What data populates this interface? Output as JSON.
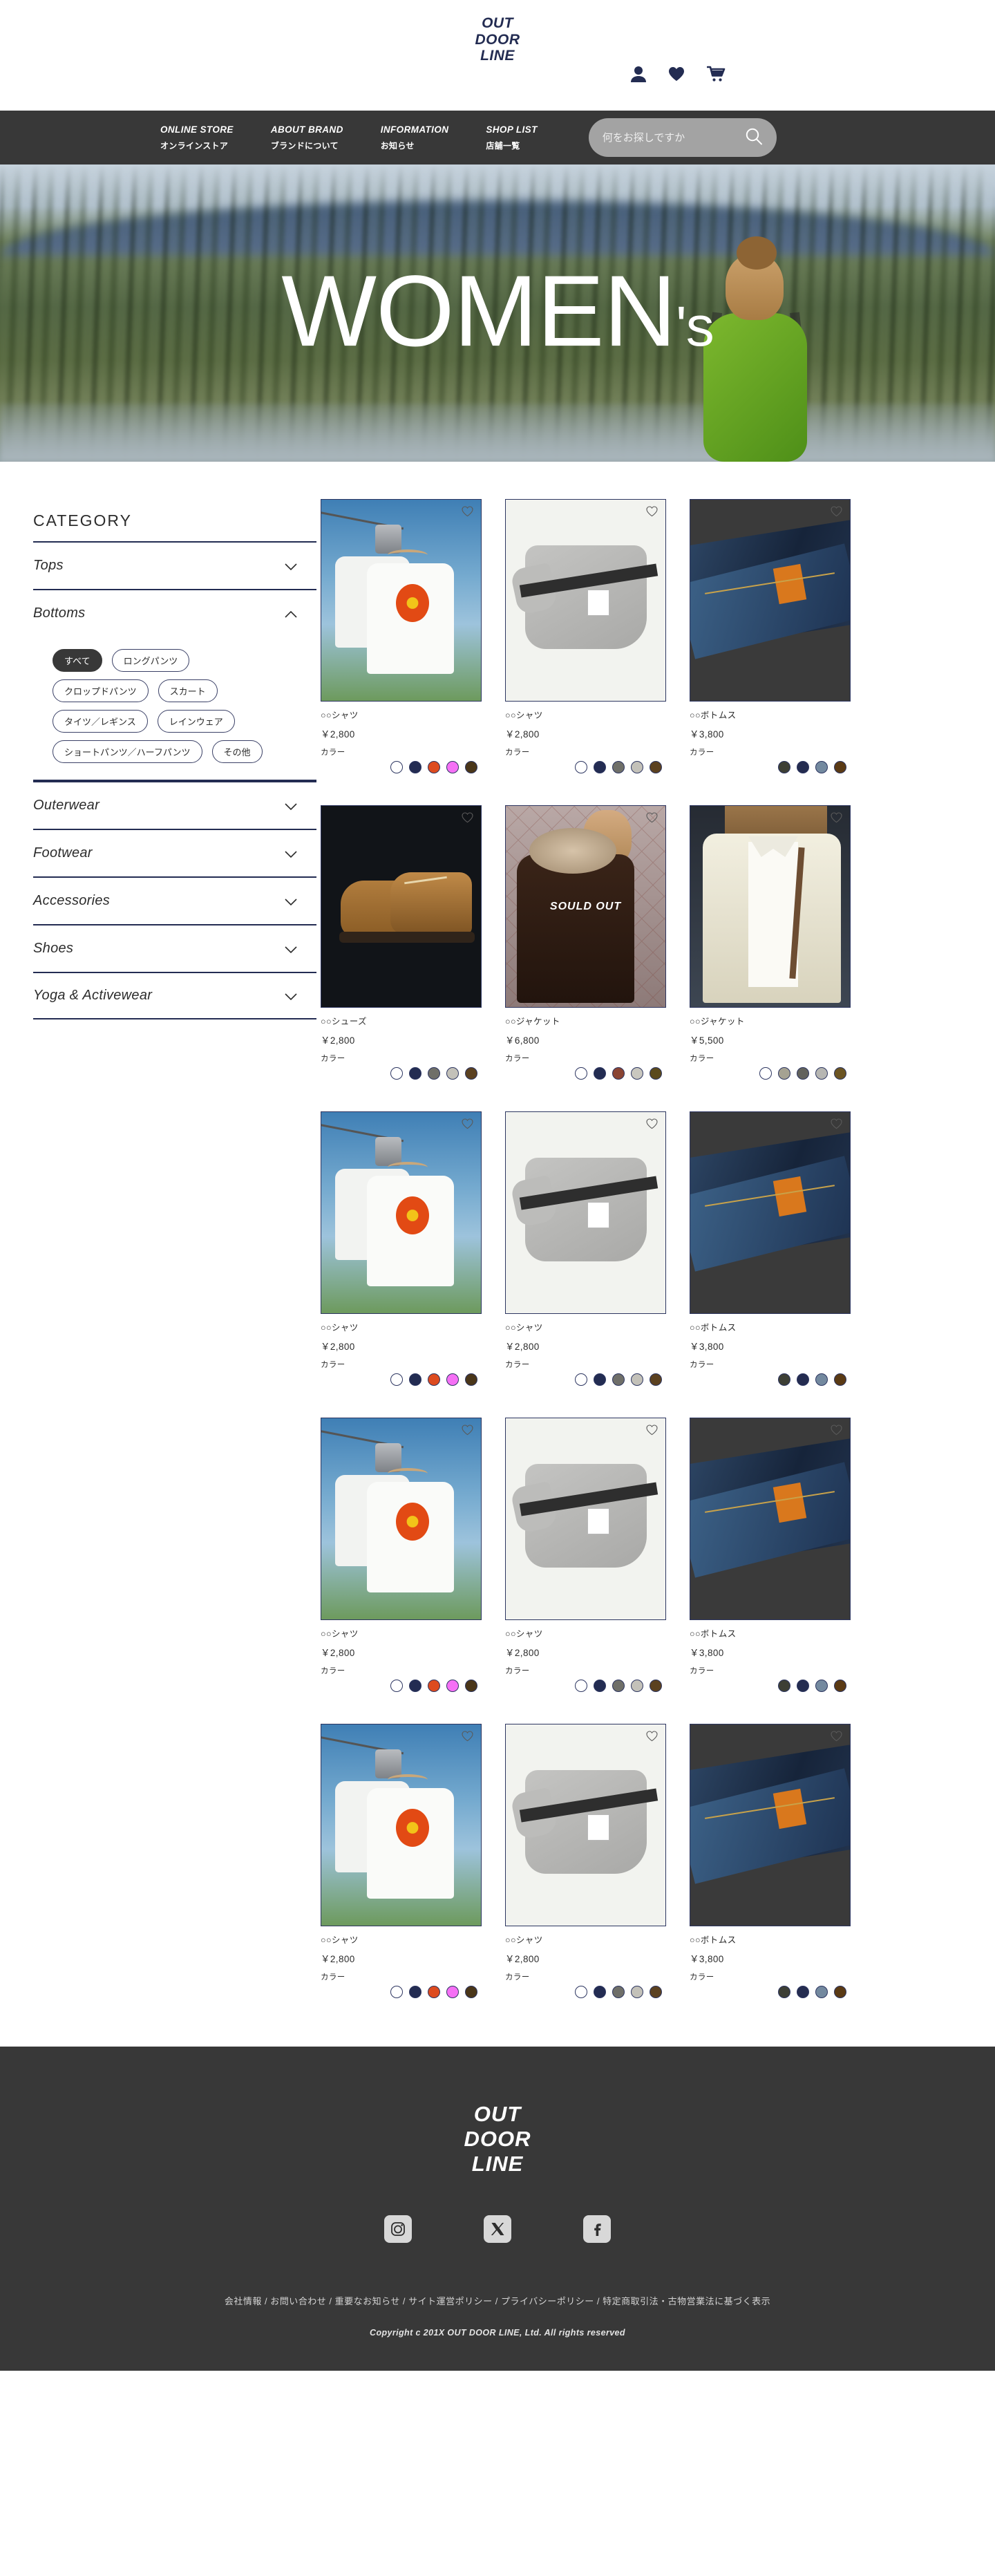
{
  "header": {
    "logo_lines": [
      "OUT",
      "DOOR",
      "LINE"
    ],
    "icons": {
      "account": "user-icon",
      "wishlist": "heart-icon",
      "cart": "cart-icon"
    }
  },
  "nav": {
    "items": [
      {
        "en": "ONLINE STORE",
        "jp": "オンラインストア"
      },
      {
        "en": "ABOUT BRAND",
        "jp": "ブランドについて"
      },
      {
        "en": "INFORMATION",
        "jp": "お知らせ"
      },
      {
        "en": "SHOP LIST",
        "jp": "店舗一覧"
      }
    ],
    "search": {
      "placeholder": "何をお探しですか",
      "value": "",
      "icon": "search-icon"
    }
  },
  "hero": {
    "title": "WOMEN",
    "apostrophe": "'s"
  },
  "sidebar": {
    "title": "CATEGORY",
    "categories": [
      {
        "label": "Tops",
        "expanded": false
      },
      {
        "label": "Bottoms",
        "expanded": true
      },
      {
        "label": "Outerwear",
        "expanded": false
      },
      {
        "label": "Footwear",
        "expanded": false
      },
      {
        "label": "Accessories",
        "expanded": false
      },
      {
        "label": "Shoes",
        "expanded": false
      },
      {
        "label": "Yoga & Activewear",
        "expanded": false
      }
    ],
    "bottoms_filters": [
      {
        "label": "すべて",
        "active": true,
        "wide": false
      },
      {
        "label": "ロングパンツ",
        "active": false,
        "wide": false
      },
      {
        "label": "クロップドパンツ",
        "active": false,
        "wide": false
      },
      {
        "label": "スカート",
        "active": false,
        "wide": false
      },
      {
        "label": "タイツ／レギンス",
        "active": false,
        "wide": false
      },
      {
        "label": "レインウェア",
        "active": false,
        "wide": false
      },
      {
        "label": "ショートパンツ／ハーフパンツ",
        "active": false,
        "wide": true
      },
      {
        "label": "その他",
        "active": false,
        "wide": false
      }
    ]
  },
  "products": {
    "color_label": "カラー",
    "soldout_label": "SOULD OUT",
    "items": [
      {
        "name": "○○シャツ",
        "price": "￥2,800",
        "photo": "shirt",
        "soldout": false,
        "colors": [
          "#ffffff",
          "#232c52",
          "#dd4b1f",
          "#f570f5",
          "#4a3619"
        ]
      },
      {
        "name": "○○シャツ",
        "price": "￥2,800",
        "photo": "tee",
        "soldout": false,
        "colors": [
          "#ffffff",
          "#232c52",
          "#6f6f69",
          "#c3c1b9",
          "#5b4120"
        ]
      },
      {
        "name": "○○ボトムス",
        "price": "￥3,800",
        "photo": "denim",
        "soldout": false,
        "colors": [
          "#3d3f35",
          "#242c50",
          "#73899f",
          "#5a3a14"
        ]
      },
      {
        "name": "○○シューズ",
        "price": "￥2,800",
        "photo": "boot",
        "soldout": false,
        "colors": [
          "#ffffff",
          "#232c52",
          "#6f6f69",
          "#c3c1b9",
          "#5b4120"
        ]
      },
      {
        "name": "○○ジャケット",
        "price": "￥6,800",
        "photo": "coat",
        "soldout": true,
        "colors": [
          "#ffffff",
          "#232c52",
          "#8a4433",
          "#c9c7bf",
          "#5b4a1c"
        ]
      },
      {
        "name": "○○ジャケット",
        "price": "￥5,500",
        "photo": "white",
        "soldout": false,
        "colors": [
          "#ffffff",
          "#a5a292",
          "#62625c",
          "#b6b6b2",
          "#6b5422"
        ]
      },
      {
        "name": "○○シャツ",
        "price": "￥2,800",
        "photo": "shirt",
        "soldout": false,
        "colors": [
          "#ffffff",
          "#232c52",
          "#dd4b1f",
          "#f570f5",
          "#4a3619"
        ]
      },
      {
        "name": "○○シャツ",
        "price": "￥2,800",
        "photo": "tee",
        "soldout": false,
        "colors": [
          "#ffffff",
          "#232c52",
          "#6f6f69",
          "#c3c1b9",
          "#5b4120"
        ]
      },
      {
        "name": "○○ボトムス",
        "price": "￥3,800",
        "photo": "denim",
        "soldout": false,
        "colors": [
          "#3d3f35",
          "#242c50",
          "#73899f",
          "#5a3a14"
        ]
      },
      {
        "name": "○○シャツ",
        "price": "￥2,800",
        "photo": "shirt",
        "soldout": false,
        "colors": [
          "#ffffff",
          "#232c52",
          "#dd4b1f",
          "#f570f5",
          "#4a3619"
        ]
      },
      {
        "name": "○○シャツ",
        "price": "￥2,800",
        "photo": "tee",
        "soldout": false,
        "colors": [
          "#ffffff",
          "#232c52",
          "#6f6f69",
          "#c3c1b9",
          "#5b4120"
        ]
      },
      {
        "name": "○○ボトムス",
        "price": "￥3,800",
        "photo": "denim",
        "soldout": false,
        "colors": [
          "#3d3f35",
          "#242c50",
          "#73899f",
          "#5a3a14"
        ]
      },
      {
        "name": "○○シャツ",
        "price": "￥2,800",
        "photo": "shirt",
        "soldout": false,
        "colors": [
          "#ffffff",
          "#232c52",
          "#dd4b1f",
          "#f570f5",
          "#4a3619"
        ]
      },
      {
        "name": "○○シャツ",
        "price": "￥2,800",
        "photo": "tee",
        "soldout": false,
        "colors": [
          "#ffffff",
          "#232c52",
          "#6f6f69",
          "#c3c1b9",
          "#5b4120"
        ]
      },
      {
        "name": "○○ボトムス",
        "price": "￥3,800",
        "photo": "denim",
        "soldout": false,
        "colors": [
          "#3d3f35",
          "#242c50",
          "#73899f",
          "#5a3a14"
        ]
      }
    ]
  },
  "footer": {
    "logo_lines": [
      "OUT",
      "DOOR",
      "LINE"
    ],
    "socials": [
      "instagram-icon",
      "x-twitter-icon",
      "facebook-icon"
    ],
    "links": "会社情報 / お問い合わせ / 重要なお知らせ / サイト運営ポリシー / プライバシーポリシー / 特定商取引法・古物営業法に基づく表示",
    "copyright": "Copyright c 201X OUT DOOR LINE, Ltd. All rights reserved"
  },
  "colors": {
    "navy": "#232c52",
    "dark": "#383838",
    "accent_orange": "#dd4b1f"
  }
}
